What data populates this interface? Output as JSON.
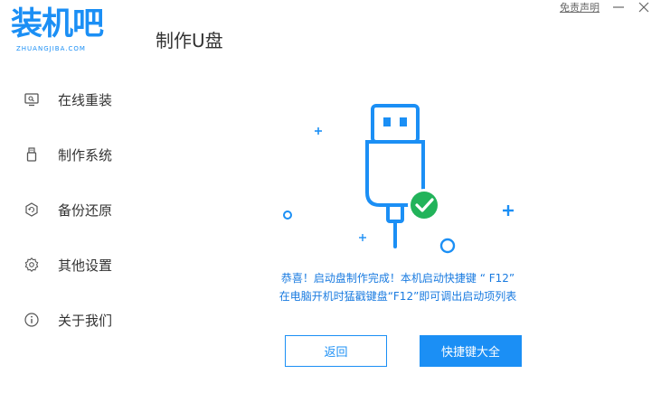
{
  "app": {
    "logo_text": "装机吧",
    "logo_subtext": "ZHUANGJIBA.COM",
    "page_title": "制作U盘",
    "disclaimer": "免责声明",
    "brand_color": "#1b8ff5",
    "success_color": "#22b35a"
  },
  "window_controls": {
    "minimize_icon": "minimize-icon",
    "close_icon": "close-icon"
  },
  "sidebar": {
    "items": [
      {
        "label": "在线重装",
        "icon": "monitor-icon"
      },
      {
        "label": "制作系统",
        "icon": "usb-drive-icon"
      },
      {
        "label": "备份还原",
        "icon": "backup-icon"
      },
      {
        "label": "其他设置",
        "icon": "gear-icon"
      },
      {
        "label": "关于我们",
        "icon": "info-icon"
      }
    ]
  },
  "main": {
    "illustration_icon": "usb-plug-success-icon",
    "message_line1": "恭喜！启动盘制作完成！本机启动快捷键 “ F12”",
    "message_line2": "在电脑开机时猛戳键盘“F12”即可调出启动项列表",
    "back_button": "返回",
    "hotkey_button": "快捷键大全"
  }
}
